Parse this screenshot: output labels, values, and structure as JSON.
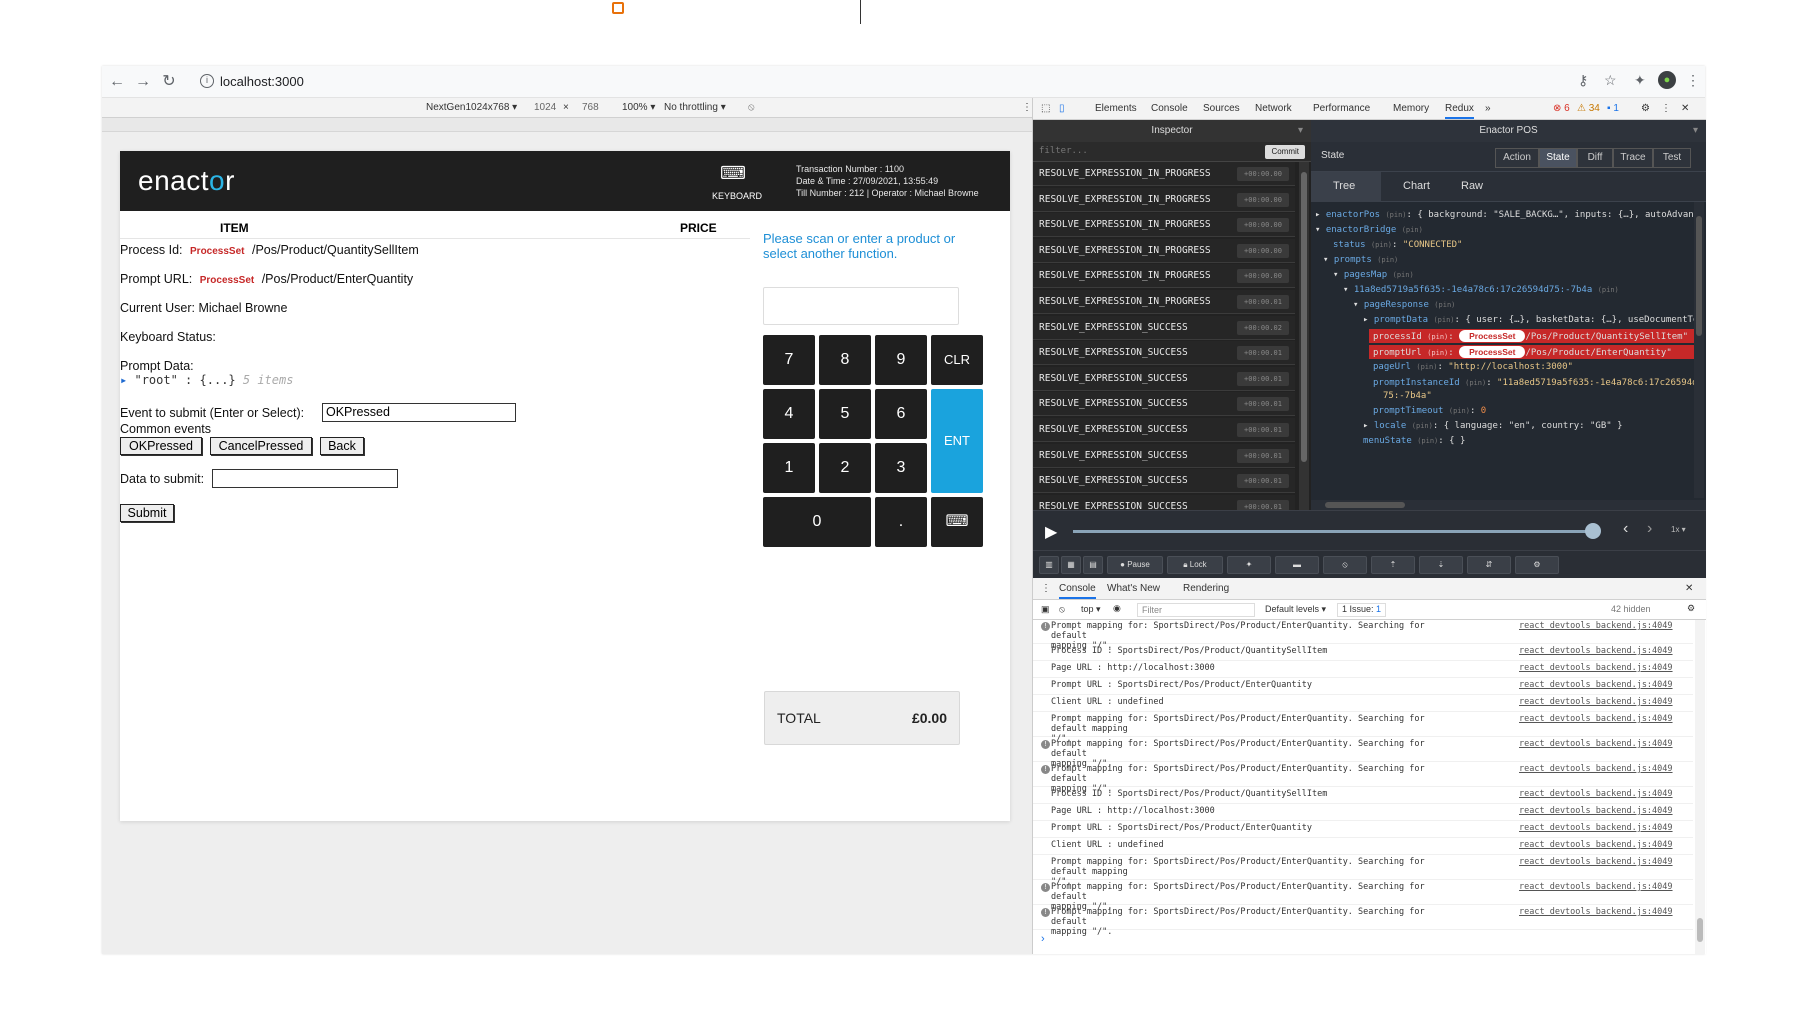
{
  "browser": {
    "url": "localhost:3000"
  },
  "device_toolbar": {
    "device": "NextGen1024x768 ▾",
    "width": "1024",
    "height": "768",
    "zoom": "100% ▾",
    "throttling": "No throttling ▾"
  },
  "app": {
    "logo": "enactor",
    "keyboard_label": "KEYBOARD",
    "txn_number": "Transaction Number : 1100",
    "date_time": "Date & Time : 27/09/2021, 13:55:49",
    "till_operator": "Till Number : 212 | Operator : Michael Browne",
    "col_item": "ITEM",
    "col_price": "PRICE",
    "process_id_label": "Process Id:",
    "process_set_tag": "ProcessSet",
    "process_id_path": "/Pos/Product/QuantitySellItem",
    "prompt_url_label": "Prompt URL:",
    "prompt_url_path": "/Pos/Product/EnterQuantity",
    "current_user": "Current User: Michael Browne",
    "keyboard_status": "Keyboard Status:",
    "prompt_data_label": "Prompt Data:",
    "root_key": "\"root\"",
    "root_value": "{...}",
    "root_hint": "5 items",
    "event_label": "Event to submit (Enter or Select):",
    "event_value": "OKPressed",
    "common_events_label": "Common events",
    "btn_ok": "OKPressed",
    "btn_cancel": "CancelPressed",
    "btn_back": "Back",
    "data_label": "Data to submit:",
    "btn_submit": "Submit",
    "prompt_message": "Please scan or enter a product or select another function.",
    "keys": {
      "k7": "7",
      "k8": "8",
      "k9": "9",
      "clr": "CLR",
      "k4": "4",
      "k5": "5",
      "k6": "6",
      "ent": "ENT",
      "k1": "1",
      "k2": "2",
      "k3": "3",
      "k0": "0",
      "dot": "."
    },
    "total_label": "TOTAL",
    "total_value": "£0.00"
  },
  "devtools": {
    "tabs": [
      "Elements",
      "Console",
      "Sources",
      "Network",
      "Performance",
      "Memory",
      "Redux"
    ],
    "errors": "6",
    "warnings": "34",
    "info": "1",
    "redux": {
      "inspector_title": "Inspector",
      "store_title": "Enactor POS",
      "filter_placeholder": "filter...",
      "commit": "Commit",
      "state_label": "State",
      "seg_buttons": [
        "Action",
        "State",
        "Diff",
        "Trace",
        "Test"
      ],
      "subtabs": [
        "Tree",
        "Chart",
        "Raw"
      ],
      "actions": [
        {
          "name": "RESOLVE_EXPRESSION_IN_PROGRESS",
          "time": "+00:00.00"
        },
        {
          "name": "RESOLVE_EXPRESSION_IN_PROGRESS",
          "time": "+00:00.00"
        },
        {
          "name": "RESOLVE_EXPRESSION_IN_PROGRESS",
          "time": "+00:00.00"
        },
        {
          "name": "RESOLVE_EXPRESSION_IN_PROGRESS",
          "time": "+00:00.00"
        },
        {
          "name": "RESOLVE_EXPRESSION_IN_PROGRESS",
          "time": "+00:00.00"
        },
        {
          "name": "RESOLVE_EXPRESSION_IN_PROGRESS",
          "time": "+00:00.01"
        },
        {
          "name": "RESOLVE_EXPRESSION_SUCCESS",
          "time": "+00:00.02"
        },
        {
          "name": "RESOLVE_EXPRESSION_SUCCESS",
          "time": "+00:00.01"
        },
        {
          "name": "RESOLVE_EXPRESSION_SUCCESS",
          "time": "+00:00.01"
        },
        {
          "name": "RESOLVE_EXPRESSION_SUCCESS",
          "time": "+00:00.01"
        },
        {
          "name": "RESOLVE_EXPRESSION_SUCCESS",
          "time": "+00:00.01"
        },
        {
          "name": "RESOLVE_EXPRESSION_SUCCESS",
          "time": "+00:00.01"
        },
        {
          "name": "RESOLVE_EXPRESSION_SUCCESS",
          "time": "+00:00.01"
        },
        {
          "name": "RESOLVE_EXPRESSION_SUCCESS",
          "time": "+00:00.01"
        }
      ],
      "tree": {
        "enactorPos": "enactorPos",
        "enactorPos_val": "{ background: \"SALE_BACKG…\", inputs: {…}, autoAdvan",
        "enactorBridge": "enactorBridge",
        "status_key": "status",
        "status_val": "\"CONNECTED\"",
        "prompts": "prompts",
        "pagesMap": "pagesMap",
        "page_id": "11a8ed5719a5f635:-1e4a78c6:17c26594d75:-7b4a",
        "pageResponse": "pageResponse",
        "promptData": "promptData",
        "promptData_val": "{ user: {…}, basketData: {…}, useDocumentTem",
        "processId_key": "processId",
        "processId_pill": "ProcessSet",
        "processId_val": "/Pos/Product/QuantitySellItem\"",
        "promptUrl_key": "promptUrl",
        "promptUrl_pill": "ProcessSet",
        "promptUrl_val": "/Pos/Product/EnterQuantity\"",
        "pageUrl_key": "pageUrl",
        "pageUrl_val": "\"http://localhost:3000\"",
        "promptInstanceId_key": "promptInstanceId",
        "promptInstanceId_val": "\"11a8ed5719a5f635:-1e4a78c6:17c26594d",
        "promptInstanceId_val2": "75:-7b4a\"",
        "promptTimeout_key": "promptTimeout",
        "promptTimeout_val": "0",
        "locale_key": "locale",
        "locale_val": "{ language: \"en\", country: \"GB\" }",
        "menuState_key": "menuState",
        "menuState_val": "{ }",
        "pin": "(pin)"
      },
      "speed": "1x",
      "tool_pause": "Pause",
      "tool_lock": "Lock"
    },
    "console": {
      "tabs": [
        "Console",
        "What's New",
        "Rendering"
      ],
      "context": "top ▾",
      "filter_placeholder": "Filter",
      "levels": "Default levels ▾",
      "issues": "1 Issue:",
      "issues_count": "1",
      "hidden": "42 hidden",
      "messages": [
        {
          "text": "Prompt mapping for: SportsDirect/Pos/Product/EnterQuantity. Searching for default\nmapping \"/\".",
          "src": "react_devtools_backend.js:4049",
          "warn": true
        },
        {
          "text": "Process ID : SportsDirect/Pos/Product/QuantitySellItem",
          "src": "react_devtools_backend.js:4049",
          "warn": false
        },
        {
          "text": "Page URL : http://localhost:3000",
          "src": "react_devtools_backend.js:4049",
          "warn": false
        },
        {
          "text": "Prompt URL : SportsDirect/Pos/Product/EnterQuantity",
          "src": "react_devtools_backend.js:4049",
          "warn": false
        },
        {
          "text": "Client URL : undefined",
          "src": "react_devtools_backend.js:4049",
          "warn": false
        },
        {
          "text": "Prompt mapping for: SportsDirect/Pos/Product/EnterQuantity. Searching for default mapping\n\"/\".",
          "src": "react_devtools_backend.js:4049",
          "warn": false
        },
        {
          "text": "Prompt mapping for: SportsDirect/Pos/Product/EnterQuantity. Searching for default\nmapping \"/\".",
          "src": "react_devtools_backend.js:4049",
          "warn": true
        },
        {
          "text": "Prompt mapping for: SportsDirect/Pos/Product/EnterQuantity. Searching for default\nmapping \"/\".",
          "src": "react_devtools_backend.js:4049",
          "warn": true
        },
        {
          "text": "Process ID : SportsDirect/Pos/Product/QuantitySellItem",
          "src": "react_devtools_backend.js:4049",
          "warn": false
        },
        {
          "text": "Page URL : http://localhost:3000",
          "src": "react_devtools_backend.js:4049",
          "warn": false
        },
        {
          "text": "Prompt URL : SportsDirect/Pos/Product/EnterQuantity",
          "src": "react_devtools_backend.js:4049",
          "warn": false
        },
        {
          "text": "Client URL : undefined",
          "src": "react_devtools_backend.js:4049",
          "warn": false
        },
        {
          "text": "Prompt mapping for: SportsDirect/Pos/Product/EnterQuantity. Searching for default mapping\n\"/\".",
          "src": "react_devtools_backend.js:4049",
          "warn": false
        },
        {
          "text": "Prompt mapping for: SportsDirect/Pos/Product/EnterQuantity. Searching for default\nmapping \"/\".",
          "src": "react_devtools_backend.js:4049",
          "warn": true
        },
        {
          "text": "Prompt mapping for: SportsDirect/Pos/Product/EnterQuantity. Searching for default\nmapping \"/\".",
          "src": "react_devtools_backend.js:4049",
          "warn": true
        }
      ]
    }
  },
  "colors": {
    "brand_accent": "#2bb5e6",
    "app_header": "#1f1f1f",
    "ent_key": "#1aa3dd",
    "highlight": "#c62828"
  }
}
